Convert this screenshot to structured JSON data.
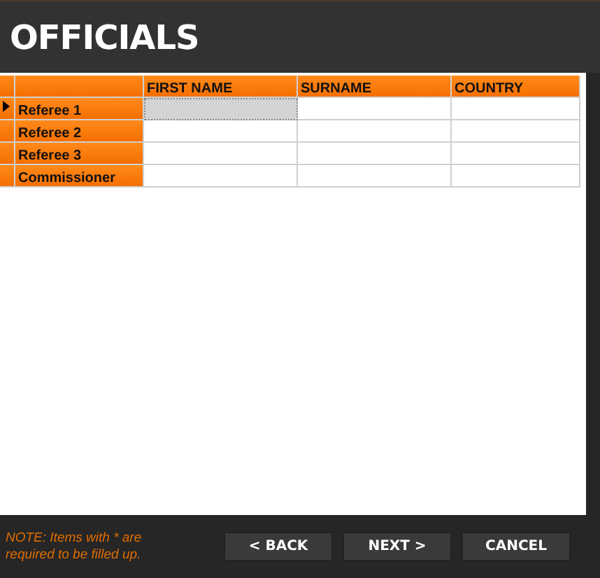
{
  "window": {
    "title": "OFFICIALS"
  },
  "table": {
    "columns": [
      "FIRST NAME",
      "SURNAME",
      "COUNTRY"
    ],
    "rows": [
      {
        "label": "Referee 1",
        "selected": true
      },
      {
        "label": "Referee 2",
        "selected": false
      },
      {
        "label": "Referee 3",
        "selected": false
      },
      {
        "label": "Commissioner",
        "selected": false
      }
    ]
  },
  "note": "NOTE: Items with * are required to be filled up.",
  "buttons": [
    "< BACK",
    "NEXT >",
    "CANCEL"
  ]
}
